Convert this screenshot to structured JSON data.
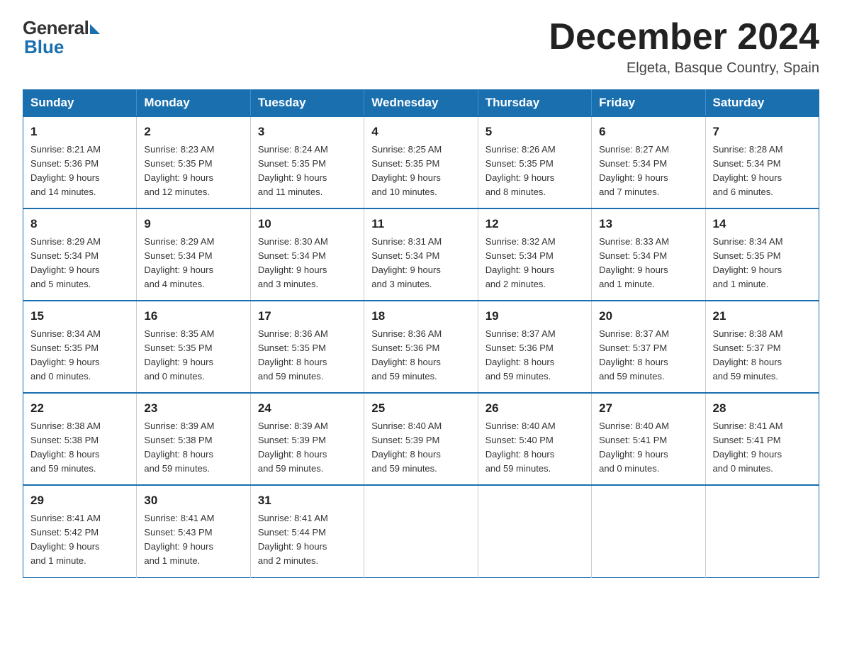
{
  "logo": {
    "general": "General",
    "blue": "Blue"
  },
  "title": {
    "month": "December 2024",
    "location": "Elgeta, Basque Country, Spain"
  },
  "days_of_week": [
    "Sunday",
    "Monday",
    "Tuesday",
    "Wednesday",
    "Thursday",
    "Friday",
    "Saturday"
  ],
  "weeks": [
    [
      {
        "day": "1",
        "info": "Sunrise: 8:21 AM\nSunset: 5:36 PM\nDaylight: 9 hours\nand 14 minutes."
      },
      {
        "day": "2",
        "info": "Sunrise: 8:23 AM\nSunset: 5:35 PM\nDaylight: 9 hours\nand 12 minutes."
      },
      {
        "day": "3",
        "info": "Sunrise: 8:24 AM\nSunset: 5:35 PM\nDaylight: 9 hours\nand 11 minutes."
      },
      {
        "day": "4",
        "info": "Sunrise: 8:25 AM\nSunset: 5:35 PM\nDaylight: 9 hours\nand 10 minutes."
      },
      {
        "day": "5",
        "info": "Sunrise: 8:26 AM\nSunset: 5:35 PM\nDaylight: 9 hours\nand 8 minutes."
      },
      {
        "day": "6",
        "info": "Sunrise: 8:27 AM\nSunset: 5:34 PM\nDaylight: 9 hours\nand 7 minutes."
      },
      {
        "day": "7",
        "info": "Sunrise: 8:28 AM\nSunset: 5:34 PM\nDaylight: 9 hours\nand 6 minutes."
      }
    ],
    [
      {
        "day": "8",
        "info": "Sunrise: 8:29 AM\nSunset: 5:34 PM\nDaylight: 9 hours\nand 5 minutes."
      },
      {
        "day": "9",
        "info": "Sunrise: 8:29 AM\nSunset: 5:34 PM\nDaylight: 9 hours\nand 4 minutes."
      },
      {
        "day": "10",
        "info": "Sunrise: 8:30 AM\nSunset: 5:34 PM\nDaylight: 9 hours\nand 3 minutes."
      },
      {
        "day": "11",
        "info": "Sunrise: 8:31 AM\nSunset: 5:34 PM\nDaylight: 9 hours\nand 3 minutes."
      },
      {
        "day": "12",
        "info": "Sunrise: 8:32 AM\nSunset: 5:34 PM\nDaylight: 9 hours\nand 2 minutes."
      },
      {
        "day": "13",
        "info": "Sunrise: 8:33 AM\nSunset: 5:34 PM\nDaylight: 9 hours\nand 1 minute."
      },
      {
        "day": "14",
        "info": "Sunrise: 8:34 AM\nSunset: 5:35 PM\nDaylight: 9 hours\nand 1 minute."
      }
    ],
    [
      {
        "day": "15",
        "info": "Sunrise: 8:34 AM\nSunset: 5:35 PM\nDaylight: 9 hours\nand 0 minutes."
      },
      {
        "day": "16",
        "info": "Sunrise: 8:35 AM\nSunset: 5:35 PM\nDaylight: 9 hours\nand 0 minutes."
      },
      {
        "day": "17",
        "info": "Sunrise: 8:36 AM\nSunset: 5:35 PM\nDaylight: 8 hours\nand 59 minutes."
      },
      {
        "day": "18",
        "info": "Sunrise: 8:36 AM\nSunset: 5:36 PM\nDaylight: 8 hours\nand 59 minutes."
      },
      {
        "day": "19",
        "info": "Sunrise: 8:37 AM\nSunset: 5:36 PM\nDaylight: 8 hours\nand 59 minutes."
      },
      {
        "day": "20",
        "info": "Sunrise: 8:37 AM\nSunset: 5:37 PM\nDaylight: 8 hours\nand 59 minutes."
      },
      {
        "day": "21",
        "info": "Sunrise: 8:38 AM\nSunset: 5:37 PM\nDaylight: 8 hours\nand 59 minutes."
      }
    ],
    [
      {
        "day": "22",
        "info": "Sunrise: 8:38 AM\nSunset: 5:38 PM\nDaylight: 8 hours\nand 59 minutes."
      },
      {
        "day": "23",
        "info": "Sunrise: 8:39 AM\nSunset: 5:38 PM\nDaylight: 8 hours\nand 59 minutes."
      },
      {
        "day": "24",
        "info": "Sunrise: 8:39 AM\nSunset: 5:39 PM\nDaylight: 8 hours\nand 59 minutes."
      },
      {
        "day": "25",
        "info": "Sunrise: 8:40 AM\nSunset: 5:39 PM\nDaylight: 8 hours\nand 59 minutes."
      },
      {
        "day": "26",
        "info": "Sunrise: 8:40 AM\nSunset: 5:40 PM\nDaylight: 8 hours\nand 59 minutes."
      },
      {
        "day": "27",
        "info": "Sunrise: 8:40 AM\nSunset: 5:41 PM\nDaylight: 9 hours\nand 0 minutes."
      },
      {
        "day": "28",
        "info": "Sunrise: 8:41 AM\nSunset: 5:41 PM\nDaylight: 9 hours\nand 0 minutes."
      }
    ],
    [
      {
        "day": "29",
        "info": "Sunrise: 8:41 AM\nSunset: 5:42 PM\nDaylight: 9 hours\nand 1 minute."
      },
      {
        "day": "30",
        "info": "Sunrise: 8:41 AM\nSunset: 5:43 PM\nDaylight: 9 hours\nand 1 minute."
      },
      {
        "day": "31",
        "info": "Sunrise: 8:41 AM\nSunset: 5:44 PM\nDaylight: 9 hours\nand 2 minutes."
      },
      {
        "day": "",
        "info": ""
      },
      {
        "day": "",
        "info": ""
      },
      {
        "day": "",
        "info": ""
      },
      {
        "day": "",
        "info": ""
      }
    ]
  ]
}
